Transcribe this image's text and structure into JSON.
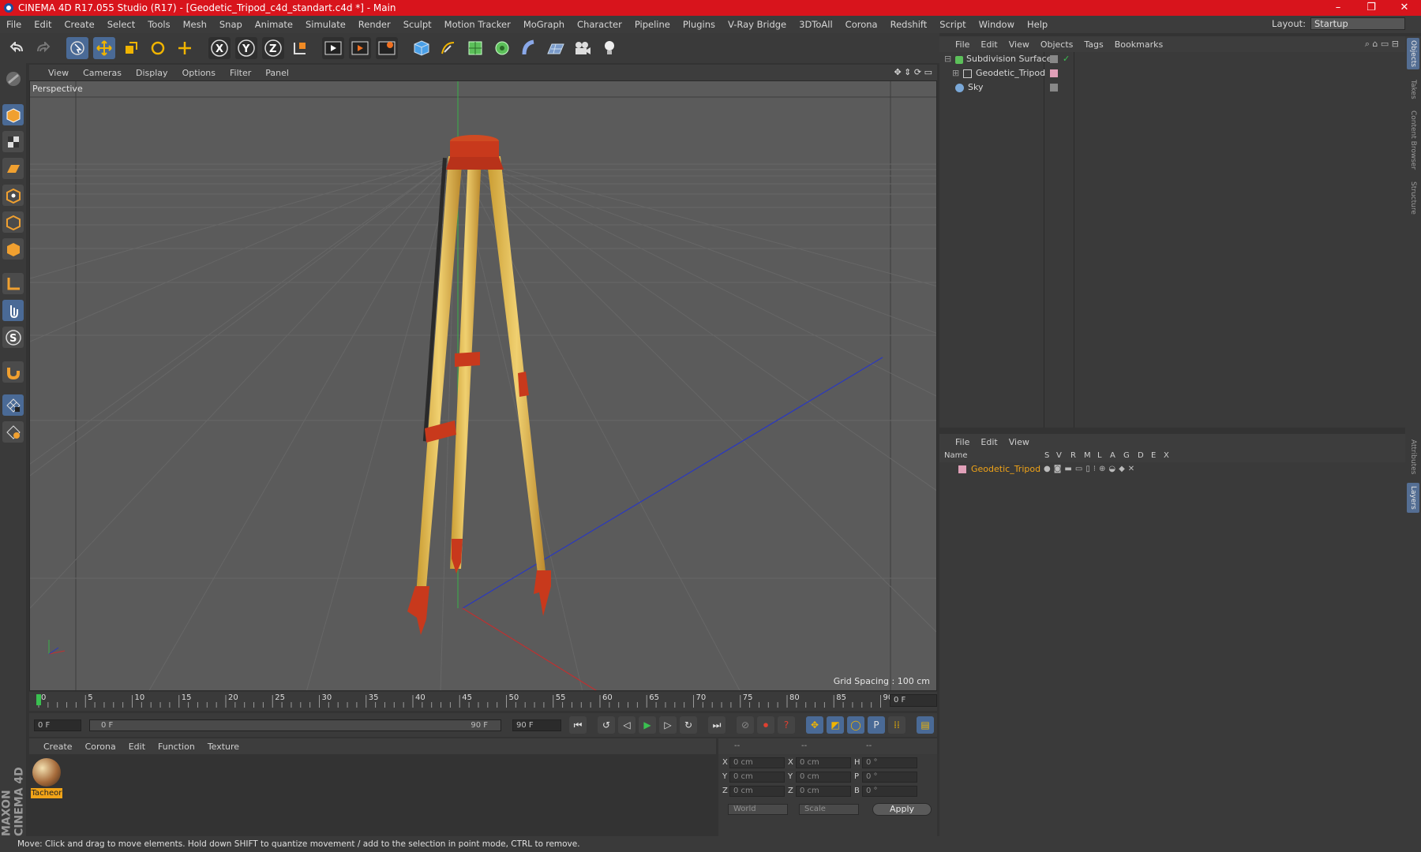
{
  "window": {
    "title": "CINEMA 4D R17.055 Studio (R17) - [Geodetic_Tripod_c4d_standart.c4d *] - Main",
    "minimize": "–",
    "maximize": "❐",
    "close": "✕"
  },
  "menubar": {
    "items": [
      "File",
      "Edit",
      "Create",
      "Select",
      "Tools",
      "Mesh",
      "Snap",
      "Animate",
      "Simulate",
      "Render",
      "Sculpt",
      "Motion Tracker",
      "MoGraph",
      "Character",
      "Pipeline",
      "Plugins",
      "V-Ray Bridge",
      "3DToAll",
      "Corona",
      "Redshift",
      "Script",
      "Window",
      "Help"
    ],
    "layout_label": "Layout:",
    "layout_value": "Startup"
  },
  "viewport": {
    "menu": [
      "View",
      "Cameras",
      "Display",
      "Options",
      "Filter",
      "Panel"
    ],
    "camera_label": "Perspective",
    "grid_spacing": "Grid Spacing : 100 cm"
  },
  "timeline": {
    "ticks": [
      "0",
      "5",
      "10",
      "15",
      "20",
      "25",
      "30",
      "35",
      "40",
      "45",
      "50",
      "55",
      "60",
      "65",
      "70",
      "75",
      "80",
      "85",
      "90"
    ],
    "current_frame": "0 F"
  },
  "transport": {
    "start_field": "0 F",
    "range_start": "0 F",
    "range_end": "90 F",
    "end_field": "90 F"
  },
  "material_manager": {
    "menu": [
      "Create",
      "Corona",
      "Edit",
      "Function",
      "Texture"
    ],
    "materials": [
      {
        "name": "Tacheor"
      }
    ]
  },
  "coordinates": {
    "headers": [
      "--",
      "--",
      "--"
    ],
    "rows": [
      {
        "axis": "X",
        "pos": "0 cm",
        "size_axis": "X",
        "size": "0 cm",
        "rot_axis": "H",
        "rot": "0 °"
      },
      {
        "axis": "Y",
        "pos": "0 cm",
        "size_axis": "Y",
        "size": "0 cm",
        "rot_axis": "P",
        "rot": "0 °"
      },
      {
        "axis": "Z",
        "pos": "0 cm",
        "size_axis": "Z",
        "size": "0 cm",
        "rot_axis": "B",
        "rot": "0 °"
      }
    ],
    "coord_system": "World",
    "mode": "Scale",
    "apply": "Apply"
  },
  "status": "Move: Click and drag to move elements. Hold down SHIFT to quantize movement / add to the selection in point mode, CTRL to remove.",
  "object_manager": {
    "menu": [
      "File",
      "Edit",
      "View",
      "Objects",
      "Tags",
      "Bookmarks"
    ],
    "objects": [
      {
        "name": "Subdivision Surface",
        "icon": "subdivision-icon"
      },
      {
        "name": "Geodetic_Tripod",
        "icon": "null-object-icon"
      },
      {
        "name": "Sky",
        "icon": "sky-icon"
      }
    ]
  },
  "layer_manager": {
    "menu": [
      "File",
      "Edit",
      "View"
    ],
    "columns": [
      "Name",
      "S",
      "V",
      "R",
      "M",
      "L",
      "A",
      "G",
      "D",
      "E",
      "X"
    ],
    "layers": [
      {
        "name": "Geodetic_Tripod",
        "color": "#e0a0b8"
      }
    ]
  },
  "side_tabs": [
    "Objects",
    "Takes",
    "Content Browser",
    "Structure",
    "Attributes",
    "Layers"
  ],
  "brand": "MAXON CINEMA 4D",
  "colors": {
    "titlebar": "#d8141c",
    "accent_blue": "#4a6a96",
    "layer_name": "#f1a418",
    "tripod_wood": "#e8c458",
    "tripod_red": "#c8391c"
  }
}
